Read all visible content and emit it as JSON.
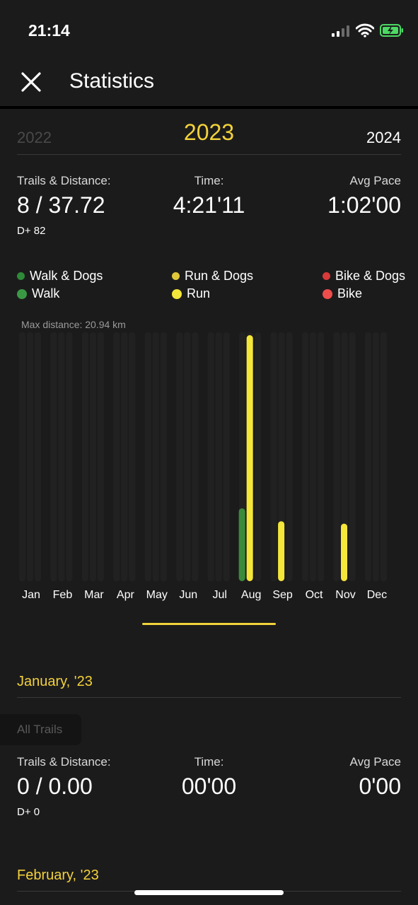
{
  "status_bar": {
    "time": "21:14"
  },
  "header": {
    "title": "Statistics"
  },
  "years": {
    "prev": "2022",
    "current": "2023",
    "next": "2024"
  },
  "summary": {
    "trails_label": "Trails & Distance:",
    "trails_value": "8 / 37.72",
    "elevation": "D+ 82",
    "time_label": "Time:",
    "time_value": "4:21'11",
    "pace_label": "Avg Pace",
    "pace_value": "1:02'00"
  },
  "legend": [
    {
      "label": "Walk & Dogs",
      "color": "#2e8a38"
    },
    {
      "label": "Walk",
      "color": "#3a9a44"
    },
    {
      "label": "Run & Dogs",
      "color": "#e0c738"
    },
    {
      "label": "Run",
      "color": "#f5e63a"
    },
    {
      "label": "Bike & Dogs",
      "color": "#d83a3a"
    },
    {
      "label": "Bike",
      "color": "#ef4c4c"
    }
  ],
  "chart_data": {
    "type": "bar",
    "title": "Max distance: 20.94 km",
    "categories": [
      "Jan",
      "Feb",
      "Mar",
      "Apr",
      "May",
      "Jun",
      "Jul",
      "Aug",
      "Sep",
      "Oct",
      "Nov",
      "Dec"
    ],
    "ylim": [
      0,
      20.94
    ],
    "series": [
      {
        "name": "Walk",
        "color": "#3a8a3c",
        "values": [
          0,
          0,
          0,
          0,
          0,
          0,
          0,
          6.2,
          0,
          0,
          0,
          0
        ]
      },
      {
        "name": "Run",
        "color": "#f5e63a",
        "values": [
          0,
          0,
          0,
          0,
          0,
          0,
          0,
          20.94,
          5.1,
          0,
          4.9,
          0
        ]
      }
    ]
  },
  "months": [
    {
      "title": "January, '23",
      "filter": "All Trails",
      "trails_label": "Trails & Distance:",
      "trails_value": "0 / 0.00",
      "elevation": "D+ 0",
      "time_label": "Time:",
      "time_value": "00'00",
      "pace_label": "Avg Pace",
      "pace_value": "0'00"
    },
    {
      "title": "February, '23"
    }
  ]
}
